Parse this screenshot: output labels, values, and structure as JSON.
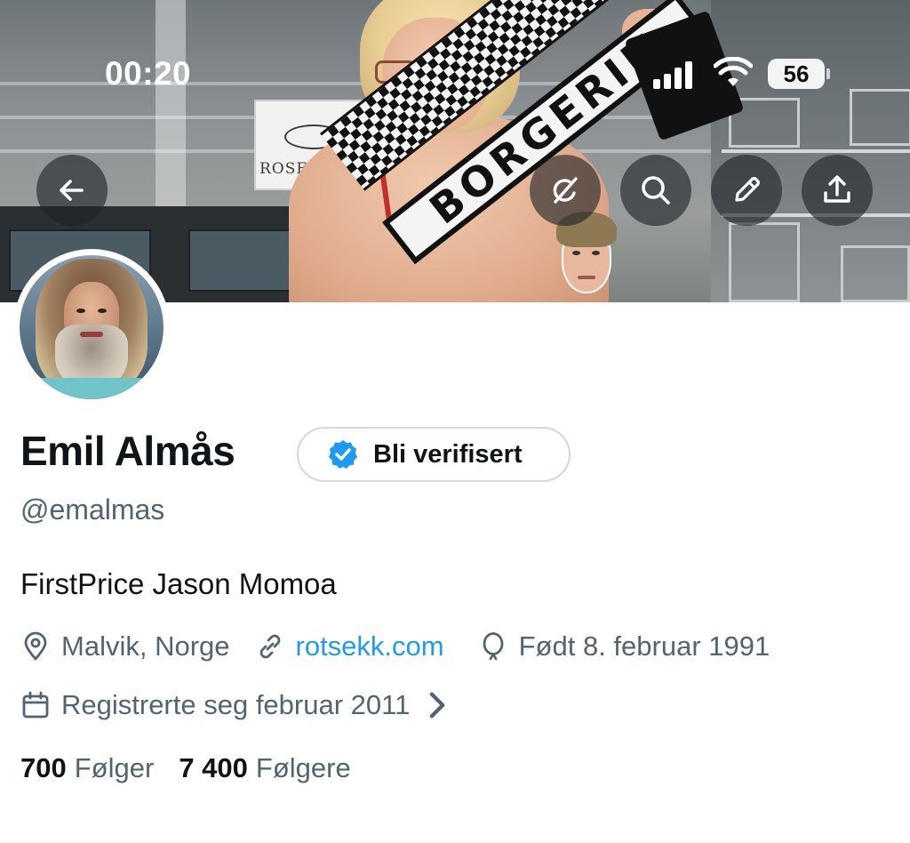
{
  "status_bar": {
    "time": "00:20",
    "battery": "56"
  },
  "banner_buttons": {
    "back": "arrow-left-icon",
    "grok": "grok-icon",
    "search": "search-icon",
    "edit": "pencil-icon",
    "share": "share-icon"
  },
  "profile": {
    "name": "Emil Almås",
    "verify_label": "Bli verifisert",
    "handle": "@emalmas",
    "bio": "FirstPrice Jason Momoa",
    "location": "Malvik, Norge",
    "website": "rotsekk.com",
    "birthday": "Født 8. februar 1991",
    "joined": "Registrerte seg februar 2011",
    "following_count": "700",
    "following_label": "Følger",
    "followers_count": "7 400",
    "followers_label": "Følgere"
  },
  "colors": {
    "accent": "#1d9bf0",
    "secondary_text": "#536471",
    "primary_text": "#0f1419",
    "border": "#cfd9de"
  }
}
